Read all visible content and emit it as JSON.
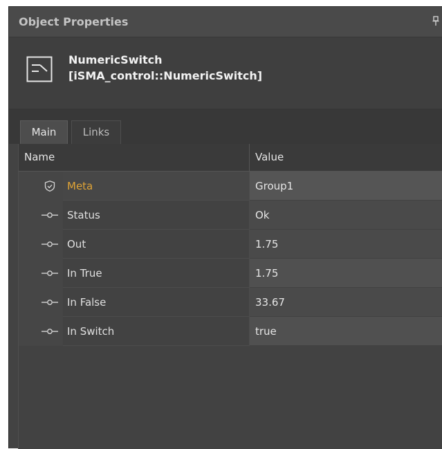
{
  "panel": {
    "title": "Object Properties",
    "pin_icon": "pin-icon"
  },
  "component": {
    "icon": "numeric-switch-icon",
    "name": "NumericSwitch",
    "type": "[iSMA_control::NumericSwitch]"
  },
  "tabs": [
    {
      "label": "Main",
      "active": true
    },
    {
      "label": "Links",
      "active": false
    }
  ],
  "table": {
    "columns": [
      "Name",
      "Value"
    ],
    "rows": [
      {
        "icon": "shield-icon",
        "name": "Meta",
        "value": "Group1"
      },
      {
        "icon": "slot-link-icon",
        "name": "Status",
        "value": "Ok"
      },
      {
        "icon": "slot-link-icon",
        "name": "Out",
        "value": "1.75"
      },
      {
        "icon": "slot-link-icon",
        "name": "In True",
        "value": "1.75"
      },
      {
        "icon": "slot-link-icon",
        "name": "In False",
        "value": "33.67"
      },
      {
        "icon": "slot-link-icon",
        "name": "In Switch",
        "value": "true"
      }
    ]
  },
  "colors": {
    "background": "#434343",
    "meta_text": "#e0a436",
    "text": "#e6e6e6"
  }
}
